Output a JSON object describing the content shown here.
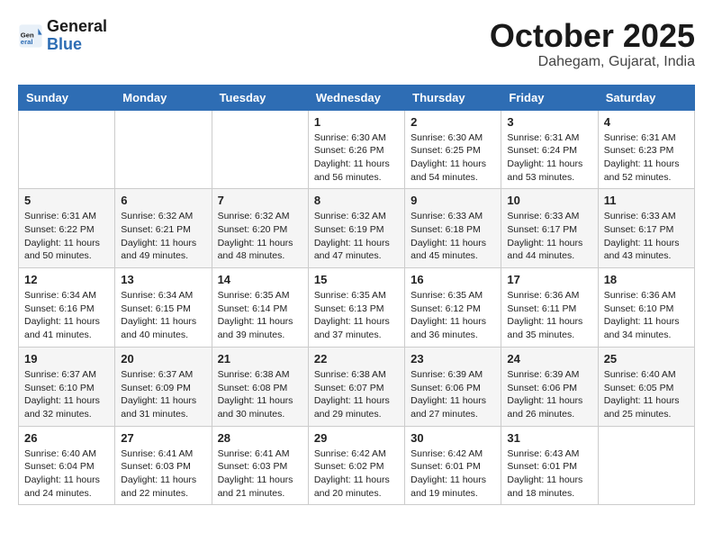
{
  "header": {
    "logo_general": "General",
    "logo_blue": "Blue",
    "month": "October 2025",
    "location": "Dahegam, Gujarat, India"
  },
  "weekdays": [
    "Sunday",
    "Monday",
    "Tuesday",
    "Wednesday",
    "Thursday",
    "Friday",
    "Saturday"
  ],
  "weeks": [
    [
      {
        "day": "",
        "info": ""
      },
      {
        "day": "",
        "info": ""
      },
      {
        "day": "",
        "info": ""
      },
      {
        "day": "1",
        "info": "Sunrise: 6:30 AM\nSunset: 6:26 PM\nDaylight: 11 hours\nand 56 minutes."
      },
      {
        "day": "2",
        "info": "Sunrise: 6:30 AM\nSunset: 6:25 PM\nDaylight: 11 hours\nand 54 minutes."
      },
      {
        "day": "3",
        "info": "Sunrise: 6:31 AM\nSunset: 6:24 PM\nDaylight: 11 hours\nand 53 minutes."
      },
      {
        "day": "4",
        "info": "Sunrise: 6:31 AM\nSunset: 6:23 PM\nDaylight: 11 hours\nand 52 minutes."
      }
    ],
    [
      {
        "day": "5",
        "info": "Sunrise: 6:31 AM\nSunset: 6:22 PM\nDaylight: 11 hours\nand 50 minutes."
      },
      {
        "day": "6",
        "info": "Sunrise: 6:32 AM\nSunset: 6:21 PM\nDaylight: 11 hours\nand 49 minutes."
      },
      {
        "day": "7",
        "info": "Sunrise: 6:32 AM\nSunset: 6:20 PM\nDaylight: 11 hours\nand 48 minutes."
      },
      {
        "day": "8",
        "info": "Sunrise: 6:32 AM\nSunset: 6:19 PM\nDaylight: 11 hours\nand 47 minutes."
      },
      {
        "day": "9",
        "info": "Sunrise: 6:33 AM\nSunset: 6:18 PM\nDaylight: 11 hours\nand 45 minutes."
      },
      {
        "day": "10",
        "info": "Sunrise: 6:33 AM\nSunset: 6:17 PM\nDaylight: 11 hours\nand 44 minutes."
      },
      {
        "day": "11",
        "info": "Sunrise: 6:33 AM\nSunset: 6:17 PM\nDaylight: 11 hours\nand 43 minutes."
      }
    ],
    [
      {
        "day": "12",
        "info": "Sunrise: 6:34 AM\nSunset: 6:16 PM\nDaylight: 11 hours\nand 41 minutes."
      },
      {
        "day": "13",
        "info": "Sunrise: 6:34 AM\nSunset: 6:15 PM\nDaylight: 11 hours\nand 40 minutes."
      },
      {
        "day": "14",
        "info": "Sunrise: 6:35 AM\nSunset: 6:14 PM\nDaylight: 11 hours\nand 39 minutes."
      },
      {
        "day": "15",
        "info": "Sunrise: 6:35 AM\nSunset: 6:13 PM\nDaylight: 11 hours\nand 37 minutes."
      },
      {
        "day": "16",
        "info": "Sunrise: 6:35 AM\nSunset: 6:12 PM\nDaylight: 11 hours\nand 36 minutes."
      },
      {
        "day": "17",
        "info": "Sunrise: 6:36 AM\nSunset: 6:11 PM\nDaylight: 11 hours\nand 35 minutes."
      },
      {
        "day": "18",
        "info": "Sunrise: 6:36 AM\nSunset: 6:10 PM\nDaylight: 11 hours\nand 34 minutes."
      }
    ],
    [
      {
        "day": "19",
        "info": "Sunrise: 6:37 AM\nSunset: 6:10 PM\nDaylight: 11 hours\nand 32 minutes."
      },
      {
        "day": "20",
        "info": "Sunrise: 6:37 AM\nSunset: 6:09 PM\nDaylight: 11 hours\nand 31 minutes."
      },
      {
        "day": "21",
        "info": "Sunrise: 6:38 AM\nSunset: 6:08 PM\nDaylight: 11 hours\nand 30 minutes."
      },
      {
        "day": "22",
        "info": "Sunrise: 6:38 AM\nSunset: 6:07 PM\nDaylight: 11 hours\nand 29 minutes."
      },
      {
        "day": "23",
        "info": "Sunrise: 6:39 AM\nSunset: 6:06 PM\nDaylight: 11 hours\nand 27 minutes."
      },
      {
        "day": "24",
        "info": "Sunrise: 6:39 AM\nSunset: 6:06 PM\nDaylight: 11 hours\nand 26 minutes."
      },
      {
        "day": "25",
        "info": "Sunrise: 6:40 AM\nSunset: 6:05 PM\nDaylight: 11 hours\nand 25 minutes."
      }
    ],
    [
      {
        "day": "26",
        "info": "Sunrise: 6:40 AM\nSunset: 6:04 PM\nDaylight: 11 hours\nand 24 minutes."
      },
      {
        "day": "27",
        "info": "Sunrise: 6:41 AM\nSunset: 6:03 PM\nDaylight: 11 hours\nand 22 minutes."
      },
      {
        "day": "28",
        "info": "Sunrise: 6:41 AM\nSunset: 6:03 PM\nDaylight: 11 hours\nand 21 minutes."
      },
      {
        "day": "29",
        "info": "Sunrise: 6:42 AM\nSunset: 6:02 PM\nDaylight: 11 hours\nand 20 minutes."
      },
      {
        "day": "30",
        "info": "Sunrise: 6:42 AM\nSunset: 6:01 PM\nDaylight: 11 hours\nand 19 minutes."
      },
      {
        "day": "31",
        "info": "Sunrise: 6:43 AM\nSunset: 6:01 PM\nDaylight: 11 hours\nand 18 minutes."
      },
      {
        "day": "",
        "info": ""
      }
    ]
  ]
}
